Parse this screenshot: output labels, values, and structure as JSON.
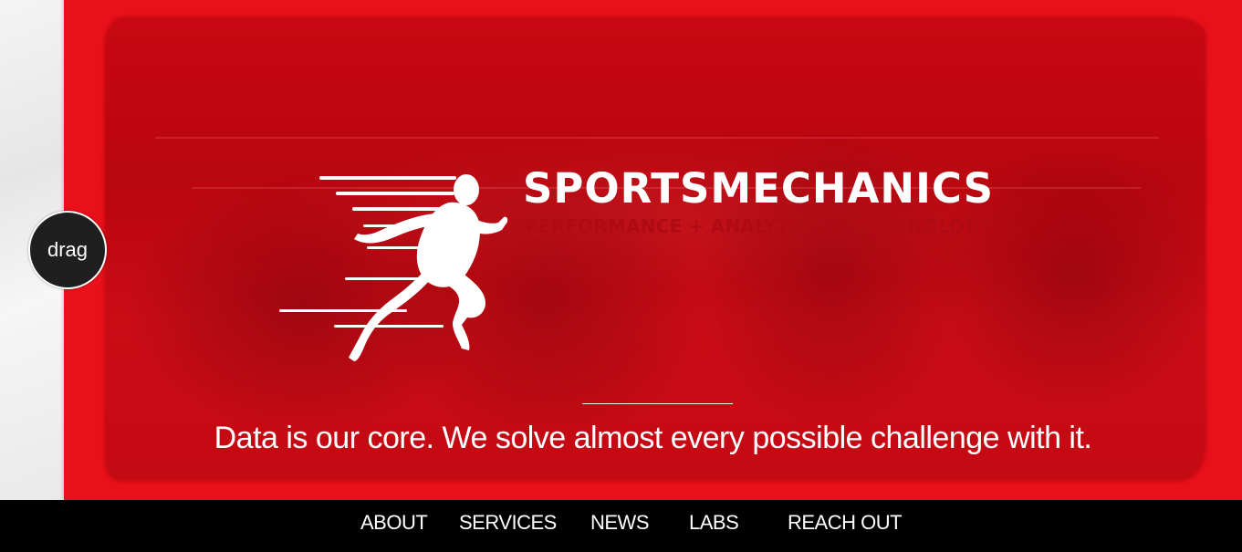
{
  "drag": {
    "label": "drag"
  },
  "brand": {
    "name": "SPORTSMECHANICS",
    "tagline": "PERFORMANCE + ANALYTICS + TECHNOLOGY"
  },
  "hero": {
    "text": "Data is our core. We solve almost every possible challenge with it."
  },
  "nav": {
    "items": [
      {
        "label": "ABOUT"
      },
      {
        "label": "SERVICES"
      },
      {
        "label": "NEWS"
      },
      {
        "label": "LABS"
      },
      {
        "label": "REACH OUT"
      }
    ]
  },
  "colors": {
    "hero_red": "#e8101a",
    "nav_background": "#000000",
    "tagline_dark_red": "#b00a12",
    "drag_button": "#1f1f1f"
  },
  "icons": {
    "logo": "running-athlete-icon"
  }
}
